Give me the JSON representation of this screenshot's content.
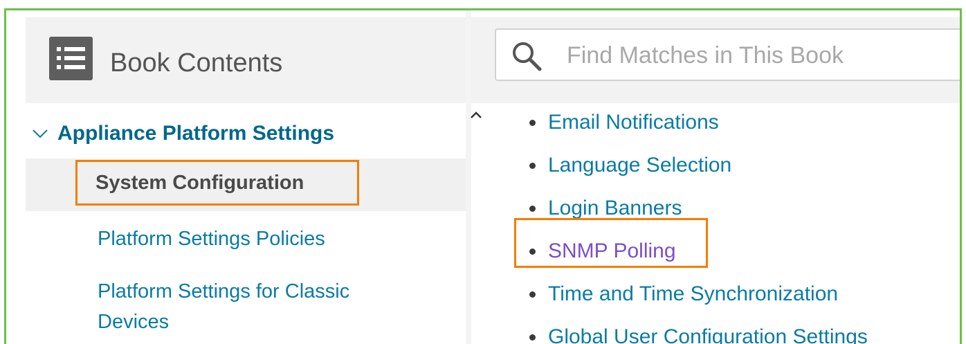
{
  "sidebar": {
    "title": "Book Contents",
    "root_label": "Appliance Platform Settings",
    "selected_item": "System Configuration",
    "items": [
      {
        "label": "Platform Settings Policies"
      },
      {
        "label": "Platform Settings for Classic Devices"
      }
    ]
  },
  "search": {
    "placeholder": "Find Matches in This Book",
    "value": ""
  },
  "content": {
    "links": [
      {
        "label": "Email Notifications",
        "state": "normal"
      },
      {
        "label": "Language Selection",
        "state": "normal"
      },
      {
        "label": "Login Banners",
        "state": "normal"
      },
      {
        "label": "SNMP Polling",
        "state": "visited"
      },
      {
        "label": "Time and Time Synchronization",
        "state": "normal"
      },
      {
        "label": "Global User Configuration Settings",
        "state": "normal"
      }
    ]
  },
  "colors": {
    "frame_border": "#6cc04a",
    "highlight_border": "#f57c00",
    "link": "#0a7ba5",
    "visited_link": "#7b4fc7",
    "root_label": "#00678b"
  },
  "icons": [
    "toc-list-icon",
    "chevron-down-icon",
    "chevron-up-icon",
    "search-icon"
  ]
}
